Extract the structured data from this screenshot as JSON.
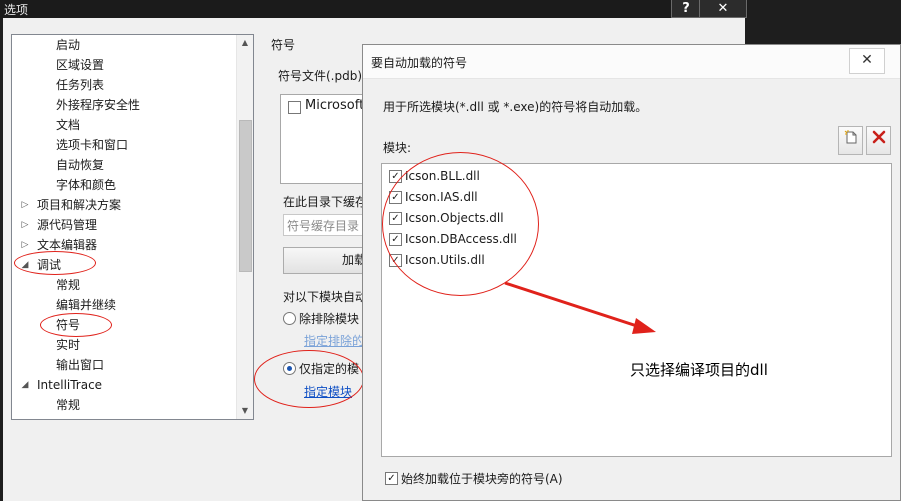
{
  "options_window": {
    "title": "选项",
    "help_label": "?",
    "close_label": "✕",
    "tree": {
      "items": [
        {
          "label": "启动",
          "level": 2
        },
        {
          "label": "区域设置",
          "level": 2
        },
        {
          "label": "任务列表",
          "level": 2
        },
        {
          "label": "外接程序安全性",
          "level": 2
        },
        {
          "label": "文档",
          "level": 2
        },
        {
          "label": "选项卡和窗口",
          "level": 2
        },
        {
          "label": "自动恢复",
          "level": 2
        },
        {
          "label": "字体和颜色",
          "level": 2
        },
        {
          "label": "项目和解决方案",
          "level": 1,
          "expander": "collapsed"
        },
        {
          "label": "源代码管理",
          "level": 1,
          "expander": "collapsed"
        },
        {
          "label": "文本编辑器",
          "level": 1,
          "expander": "collapsed"
        },
        {
          "label": "调试",
          "level": 1,
          "expander": "expanded"
        },
        {
          "label": "常规",
          "level": 2
        },
        {
          "label": "编辑并继续",
          "level": 2
        },
        {
          "label": "符号",
          "level": 2
        },
        {
          "label": "实时",
          "level": 2
        },
        {
          "label": "输出窗口",
          "level": 2
        },
        {
          "label": "IntelliTrace",
          "level": 1,
          "expander": "expanded"
        },
        {
          "label": "常规",
          "level": 2
        }
      ]
    },
    "symbols": {
      "heading": "符号",
      "pdb_locations_label": "符号文件(.pdb)",
      "microsoft_server_label": "Microsoft",
      "cache_dir_label": "在此目录下缓存",
      "cache_dir_placeholder": "符号缓存目录",
      "load_button_label": "加载",
      "auto_load_label": "对以下模块自动",
      "radio_exclude_label": "除排除模块",
      "exclude_link": "指定排除的",
      "radio_only_label": "仅指定的模",
      "only_link": "指定模块"
    }
  },
  "dialog": {
    "title": "要自动加载的符号",
    "close_label": "✕",
    "description": "用于所选模块(*.dll 或 *.exe)的符号将自动加载。",
    "modules_label": "模块:",
    "new_icon": "new-item-icon",
    "delete_icon": "delete-icon",
    "modules": [
      {
        "name": "Icson.BLL.dll",
        "checked": true
      },
      {
        "name": "Icson.IAS.dll",
        "checked": true
      },
      {
        "name": "Icson.Objects.dll",
        "checked": true
      },
      {
        "name": "Icson.DBAccess.dll",
        "checked": true
      },
      {
        "name": "Icson.Utils.dll",
        "checked": true
      }
    ],
    "always_load_label": "始终加载位于模块旁的符号(A)",
    "always_load_checked": true
  },
  "annotation": {
    "text": "只选择编译项目的dll",
    "color": "#e0221b"
  }
}
